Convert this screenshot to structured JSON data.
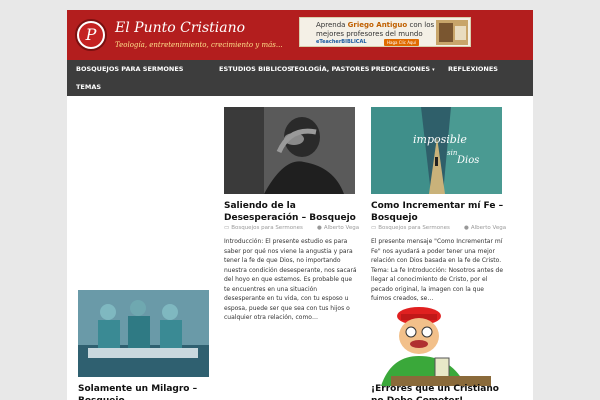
{
  "header": {
    "logo_letter": "P",
    "title": "El Punto Cristiano",
    "tagline": "Teología, entretenimiento, crecimiento y más..."
  },
  "ad": {
    "line1_pre": "Aprenda",
    "line1_highlight": "Griego Antiguo",
    "line1_post": "con los",
    "line2": "mejores profesores del mundo",
    "brand": "eTeacherBIBLICAL",
    "cta": "Haga Clic Aquí"
  },
  "nav": {
    "items": [
      {
        "label": "BOSQUEJOS PARA SERMONES"
      },
      {
        "label": "ESTUDIOS BIBLICOS"
      },
      {
        "label": "TEOLOGÍA, PASTORES"
      },
      {
        "label": "PREDICACIONES"
      },
      {
        "label": "REFLEXIONES"
      },
      {
        "label": "TEMAS"
      }
    ]
  },
  "posts": [
    {
      "title": "Saliendo de la Desesperación – Bosquejo",
      "category": "Bosquejos para Sermones",
      "author": "Alberto Vega",
      "excerpt": "Introducción: El presente estudio es para saber por qué nos viene la angustia y para tener la fe de que Dios, no importando nuestra condición desesperante, nos sacará del hoyo en que estemos. Es probable que te encuentres en una situación desesperante en tu vida, con tu esposo u esposa, puede ser que sea con tus hijos o cualquier otra relación, como…"
    },
    {
      "title": "Como Incrementar mí Fe – Bosquejo",
      "category": "Bosquejos para Sermones",
      "author": "Alberto Vega",
      "image_text_1": "imposible",
      "image_text_2": "sin",
      "image_text_3": "Dios",
      "excerpt": "El presente mensaje \"Como Incrementar mí Fe\" nos ayudará a poder tener una mejor relación con Dios basada en la fe de Cristo. Tema: La fe Introducción: Nosotros antes de llegar al conocimiento de Cristo, por el pecado original, la imagen con la que fuimos creados, se…"
    },
    {
      "title": "Solamente un Milagro – Bosquejo"
    },
    {
      "title": "¡Errores que un Cristiano no Debe Cometer!"
    }
  ],
  "icons": {
    "folder": "folder-icon",
    "user": "user-icon",
    "chevron": "chevron-down-icon"
  },
  "colors": {
    "header": "#b31e1e",
    "nav": "#3d3d3d",
    "tagline": "#ffe08a"
  }
}
